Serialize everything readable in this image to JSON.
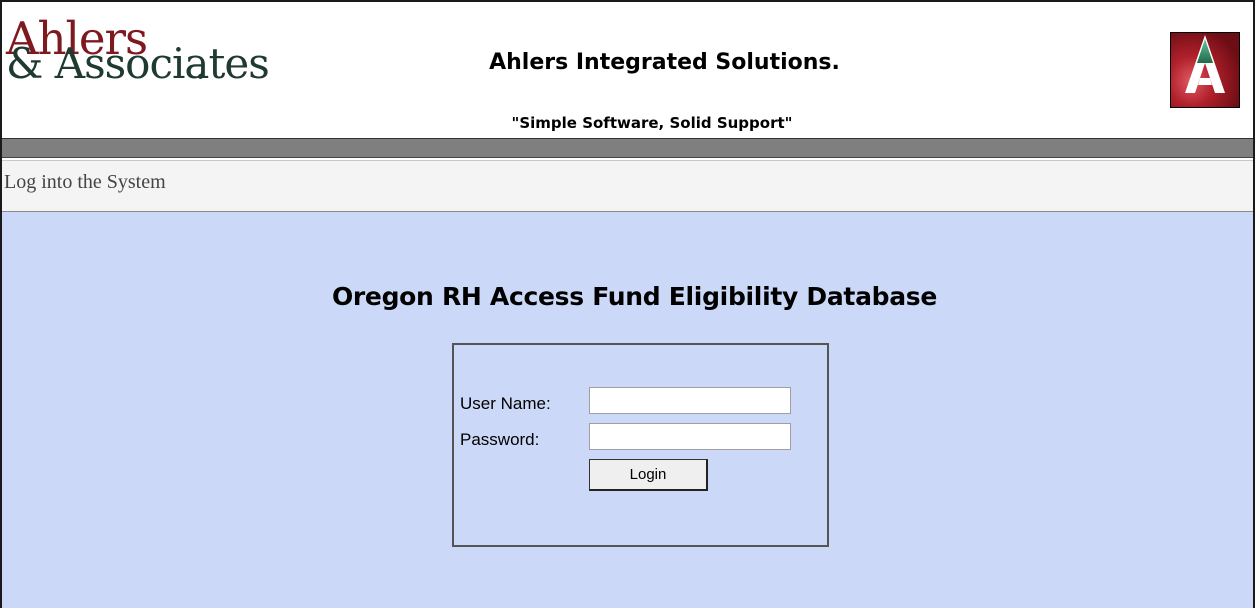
{
  "header": {
    "logo_line1": "Ahlers",
    "logo_line2": "& Associates",
    "company_title": "Ahlers Integrated Solutions.",
    "tagline": "\"Simple Software, Solid Support\"",
    "brand_icon": "ahlers-a-logo-icon"
  },
  "subbar": {
    "text": "Log into the System"
  },
  "main": {
    "page_title": "Oregon RH Access Fund Eligibility Database",
    "login": {
      "username_label": "User Name:",
      "username_value": "",
      "password_label": "Password:",
      "password_value": "",
      "login_button": "Login"
    }
  },
  "colors": {
    "logo_red": "#7e1a1f",
    "logo_green": "#1f3a30",
    "gray_bar": "#7f7f7f",
    "main_background": "#ccd8f7"
  }
}
